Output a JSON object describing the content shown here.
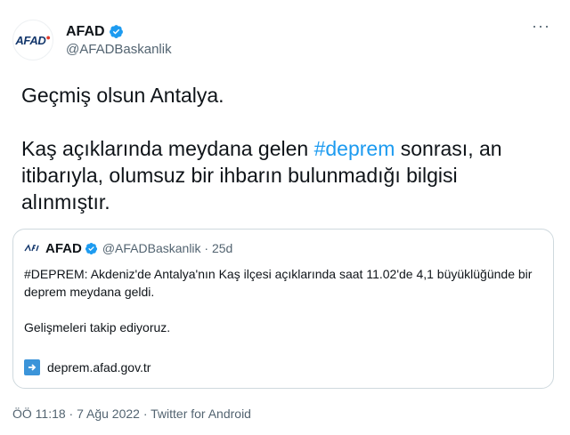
{
  "author": {
    "display_name": "AFAD",
    "handle": "@AFADBaskanlik",
    "avatar_logo": "AFAD"
  },
  "more_label": "···",
  "tweet": {
    "line1": "Geçmiş olsun Antalya.",
    "line2_pre": "Kaş açıklarında meydana gelen ",
    "hashtag": "#deprem",
    "line2_post": " sonrası, an itibarıyla, olumsuz bir ihbarın bulunmadığı bilgisi alınmıştır."
  },
  "quoted": {
    "display_name": "AFAD",
    "handle_time": "@AFADBaskanlik · 25d",
    "text1": "#DEPREM: Akdeniz'de Antalya'nın Kaş ilçesi açıklarında saat 11.02'de 4,1 büyüklüğünde bir deprem meydana geldi.",
    "text2": "Gelişmeleri takip ediyoruz.",
    "link": "deprem.afad.gov.tr"
  },
  "meta": "ÖÖ 11:18 · 7 Ağu 2022 · Twitter for Android",
  "colors": {
    "accent": "#1d9bf0",
    "text": "#0f1419",
    "muted": "#536471",
    "border": "#cfd9de"
  }
}
